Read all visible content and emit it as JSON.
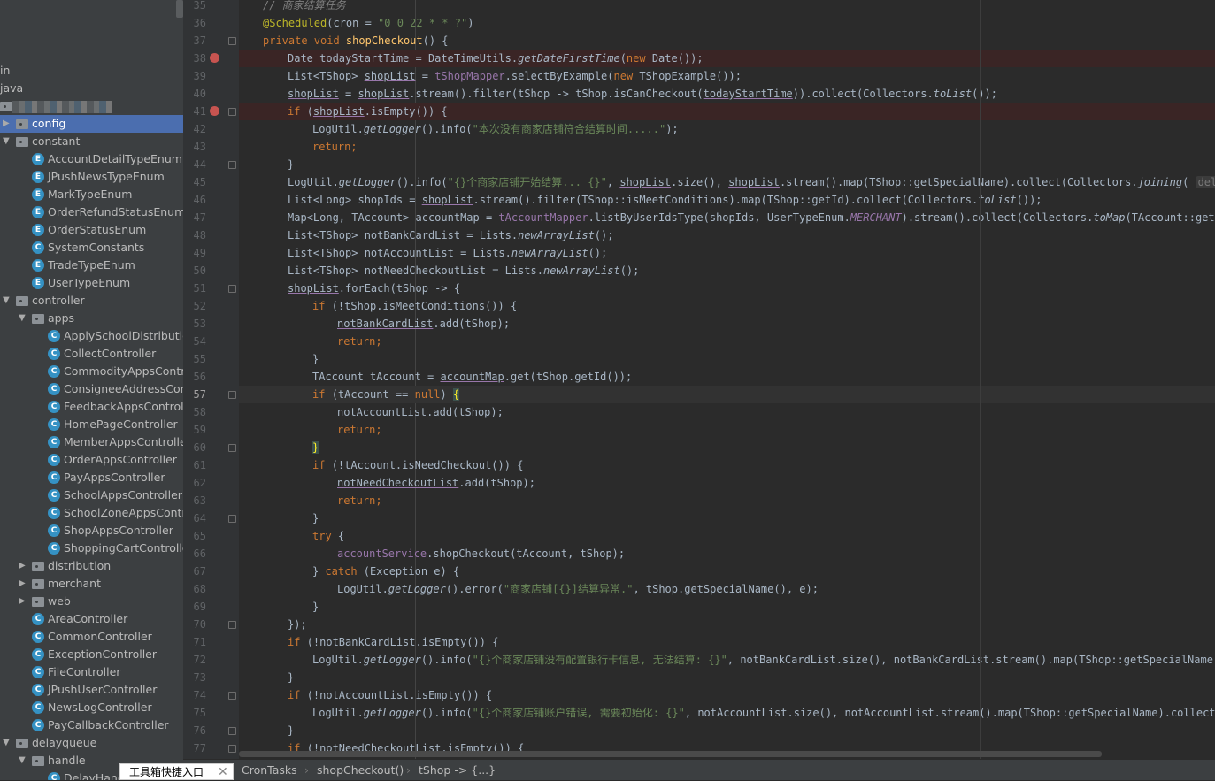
{
  "sidebar": {
    "rows": [
      {
        "label": "in",
        "level": -1,
        "kind": "none"
      },
      {
        "label": "java",
        "level": -1,
        "kind": "none"
      },
      {
        "label": "",
        "level": -1,
        "kind": "package-blurred"
      },
      {
        "label": "config",
        "level": 0,
        "kind": "folder",
        "arrow": "collapsed",
        "selected": true
      },
      {
        "label": "constant",
        "level": 0,
        "kind": "folder",
        "arrow": "expanded"
      },
      {
        "label": "AccountDetailTypeEnum",
        "level": 1,
        "kind": "enum"
      },
      {
        "label": "JPushNewsTypeEnum",
        "level": 1,
        "kind": "enum"
      },
      {
        "label": "MarkTypeEnum",
        "level": 1,
        "kind": "enum"
      },
      {
        "label": "OrderRefundStatusEnum",
        "level": 1,
        "kind": "enum"
      },
      {
        "label": "OrderStatusEnum",
        "level": 1,
        "kind": "enum"
      },
      {
        "label": "SystemConstants",
        "level": 1,
        "kind": "class"
      },
      {
        "label": "TradeTypeEnum",
        "level": 1,
        "kind": "enum"
      },
      {
        "label": "UserTypeEnum",
        "level": 1,
        "kind": "enum"
      },
      {
        "label": "controller",
        "level": 0,
        "kind": "folder",
        "arrow": "expanded"
      },
      {
        "label": "apps",
        "level": 1,
        "kind": "folder",
        "arrow": "expanded"
      },
      {
        "label": "ApplySchoolDistribution",
        "level": 2,
        "kind": "class"
      },
      {
        "label": "CollectController",
        "level": 2,
        "kind": "class"
      },
      {
        "label": "CommodityAppsContro",
        "level": 2,
        "kind": "class"
      },
      {
        "label": "ConsigneeAddressCont",
        "level": 2,
        "kind": "class"
      },
      {
        "label": "FeedbackAppsControlle",
        "level": 2,
        "kind": "class"
      },
      {
        "label": "HomePageController",
        "level": 2,
        "kind": "class"
      },
      {
        "label": "MemberAppsController",
        "level": 2,
        "kind": "class"
      },
      {
        "label": "OrderAppsController",
        "level": 2,
        "kind": "class"
      },
      {
        "label": "PayAppsController",
        "level": 2,
        "kind": "class"
      },
      {
        "label": "SchoolAppsController",
        "level": 2,
        "kind": "class"
      },
      {
        "label": "SchoolZoneAppsContro",
        "level": 2,
        "kind": "class"
      },
      {
        "label": "ShopAppsController",
        "level": 2,
        "kind": "class"
      },
      {
        "label": "ShoppingCartController",
        "level": 2,
        "kind": "class"
      },
      {
        "label": "distribution",
        "level": 1,
        "kind": "folder",
        "arrow": "collapsed"
      },
      {
        "label": "merchant",
        "level": 1,
        "kind": "folder",
        "arrow": "collapsed"
      },
      {
        "label": "web",
        "level": 1,
        "kind": "folder",
        "arrow": "collapsed"
      },
      {
        "label": "AreaController",
        "level": 1,
        "kind": "class"
      },
      {
        "label": "CommonController",
        "level": 1,
        "kind": "class"
      },
      {
        "label": "ExceptionController",
        "level": 1,
        "kind": "class"
      },
      {
        "label": "FileController",
        "level": 1,
        "kind": "class"
      },
      {
        "label": "JPushUserController",
        "level": 1,
        "kind": "class"
      },
      {
        "label": "NewsLogController",
        "level": 1,
        "kind": "class"
      },
      {
        "label": "PayCallbackController",
        "level": 1,
        "kind": "class"
      },
      {
        "label": "delayqueue",
        "level": 0,
        "kind": "folder",
        "arrow": "expanded"
      },
      {
        "label": "handle",
        "level": 1,
        "kind": "folder",
        "arrow": "expanded"
      },
      {
        "label": "DelayHand",
        "level": 2,
        "kind": "class"
      }
    ]
  },
  "editor": {
    "first_line": 35,
    "breakpoints": [
      38,
      41
    ],
    "current_line": 57,
    "folds": [
      37,
      41,
      44,
      51,
      57,
      60,
      64,
      70,
      74,
      76,
      77
    ],
    "lines": [
      {
        "indent": 0,
        "t": [
          [
            "c",
            "// 商家结算任务"
          ]
        ]
      },
      {
        "indent": 0,
        "t": [
          [
            "a",
            "@Scheduled"
          ],
          [
            "",
            "(cron = "
          ],
          [
            "s",
            "\"0 0 22 * * ?\""
          ],
          [
            "",
            ")"
          ]
        ]
      },
      {
        "indent": 0,
        "t": [
          [
            "k",
            "private void "
          ],
          [
            "m",
            "shopCheckout"
          ],
          [
            "",
            "() {"
          ]
        ]
      },
      {
        "indent": 1,
        "t": [
          [
            "",
            "Date todayStartTime = DateTimeUtils."
          ],
          [
            "i",
            "getDateFirstTime"
          ],
          [
            "",
            "("
          ],
          [
            "k",
            "new "
          ],
          [
            "",
            "Date());"
          ]
        ]
      },
      {
        "indent": 1,
        "t": [
          [
            "",
            "List<TShop> "
          ],
          [
            "u",
            "shopList"
          ],
          [
            "",
            " = "
          ],
          [
            "f",
            "tShopMapper"
          ],
          [
            "",
            ".selectByExample("
          ],
          [
            "k",
            "new "
          ],
          [
            "",
            "TShopExample());"
          ]
        ]
      },
      {
        "indent": 1,
        "t": [
          [
            "u",
            "shopList"
          ],
          [
            "",
            " = "
          ],
          [
            "u",
            "shopList"
          ],
          [
            "",
            ".stream().filter(tShop -> tShop.isCanCheckout("
          ],
          [
            "u",
            "todayStartTime"
          ],
          [
            "",
            ")).collect(Collectors."
          ],
          [
            "i",
            "toList"
          ],
          [
            "",
            "());"
          ]
        ]
      },
      {
        "indent": 1,
        "t": [
          [
            "k",
            "if "
          ],
          [
            "",
            "("
          ],
          [
            "u",
            "shopList"
          ],
          [
            "",
            ".isEmpty()) {"
          ]
        ]
      },
      {
        "indent": 2,
        "t": [
          [
            "",
            "LogUtil."
          ],
          [
            "i",
            "getLogger"
          ],
          [
            "",
            "().info("
          ],
          [
            "s",
            "\"本次没有商家店铺符合结算时间.....\""
          ],
          [
            "",
            ");"
          ]
        ]
      },
      {
        "indent": 2,
        "t": [
          [
            "k",
            "return;"
          ]
        ]
      },
      {
        "indent": 1,
        "t": [
          [
            "",
            "}"
          ]
        ]
      },
      {
        "indent": 1,
        "t": [
          [
            "",
            "LogUtil."
          ],
          [
            "i",
            "getLogger"
          ],
          [
            "",
            "().info("
          ],
          [
            "s",
            "\"{}个商家店铺开始结算... {}\""
          ],
          [
            "",
            ", "
          ],
          [
            "u",
            "shopList"
          ],
          [
            "",
            ".size(), "
          ],
          [
            "u",
            "shopList"
          ],
          [
            "",
            ".stream().map(TShop::getSpecialName).collect(Collectors."
          ],
          [
            "i",
            "joining"
          ],
          [
            "",
            "( "
          ],
          [
            "h",
            "delimiter"
          ]
        ]
      },
      {
        "indent": 1,
        "t": [
          [
            "",
            "List<Long> shopIds = "
          ],
          [
            "u",
            "shopList"
          ],
          [
            "",
            ".stream().filter(TShop::isMeetConditions).map(TShop::getId).collect(Collectors."
          ],
          [
            "i",
            "toList"
          ],
          [
            "",
            "());"
          ]
        ]
      },
      {
        "indent": 1,
        "t": [
          [
            "",
            "Map<Long, TAccount> accountMap = "
          ],
          [
            "f",
            "tAccountMapper"
          ],
          [
            "",
            ".listByUserIdsType(shopIds, UserTypeEnum."
          ],
          [
            "fi",
            "MERCHANT"
          ],
          [
            "",
            ").stream().collect(Collectors."
          ],
          [
            "i",
            "toMap"
          ],
          [
            "",
            "(TAccount::getUserId"
          ]
        ]
      },
      {
        "indent": 1,
        "t": [
          [
            "",
            "List<TShop> notBankCardList = Lists."
          ],
          [
            "i",
            "newArrayList"
          ],
          [
            "",
            "();"
          ]
        ]
      },
      {
        "indent": 1,
        "t": [
          [
            "",
            "List<TShop> notAccountList = Lists."
          ],
          [
            "i",
            "newArrayList"
          ],
          [
            "",
            "();"
          ]
        ]
      },
      {
        "indent": 1,
        "t": [
          [
            "",
            "List<TShop> notNeedCheckoutList = Lists."
          ],
          [
            "i",
            "newArrayList"
          ],
          [
            "",
            "();"
          ]
        ]
      },
      {
        "indent": 1,
        "t": [
          [
            "u",
            "shopList"
          ],
          [
            "",
            ".forEach(tShop -> {"
          ]
        ]
      },
      {
        "indent": 2,
        "t": [
          [
            "k",
            "if "
          ],
          [
            "",
            "(!tShop.isMeetConditions()) {"
          ]
        ]
      },
      {
        "indent": 3,
        "t": [
          [
            "u",
            "notBankCardList"
          ],
          [
            "",
            ".add(tShop);"
          ]
        ]
      },
      {
        "indent": 3,
        "t": [
          [
            "k",
            "return;"
          ]
        ]
      },
      {
        "indent": 2,
        "t": [
          [
            "",
            "}"
          ]
        ]
      },
      {
        "indent": 2,
        "t": [
          [
            "",
            "TAccount tAccount = "
          ],
          [
            "u",
            "accountMap"
          ],
          [
            "",
            ".get(tShop.getId());"
          ]
        ]
      },
      {
        "indent": 2,
        "t": [
          [
            "k",
            "if "
          ],
          [
            "",
            "(tAccount == "
          ],
          [
            "k",
            "null"
          ],
          [
            "",
            ") "
          ],
          [
            "b",
            "{"
          ]
        ]
      },
      {
        "indent": 3,
        "t": [
          [
            "u",
            "notAccountList"
          ],
          [
            "",
            ".add(tShop);"
          ]
        ]
      },
      {
        "indent": 3,
        "t": [
          [
            "k",
            "return;"
          ]
        ]
      },
      {
        "indent": 2,
        "t": [
          [
            "b",
            "}"
          ]
        ]
      },
      {
        "indent": 2,
        "t": [
          [
            "k",
            "if "
          ],
          [
            "",
            "(!tAccount.isNeedCheckout()) {"
          ]
        ]
      },
      {
        "indent": 3,
        "t": [
          [
            "u",
            "notNeedCheckoutList"
          ],
          [
            "",
            ".add(tShop);"
          ]
        ]
      },
      {
        "indent": 3,
        "t": [
          [
            "k",
            "return;"
          ]
        ]
      },
      {
        "indent": 2,
        "t": [
          [
            "",
            "}"
          ]
        ]
      },
      {
        "indent": 2,
        "t": [
          [
            "k",
            "try"
          ],
          [
            "",
            " {"
          ]
        ]
      },
      {
        "indent": 3,
        "t": [
          [
            "f",
            "accountService"
          ],
          [
            "",
            ".shopCheckout(tAccount, tShop);"
          ]
        ]
      },
      {
        "indent": 2,
        "t": [
          [
            "",
            "} "
          ],
          [
            "k",
            "catch"
          ],
          [
            "",
            " (Exception e) {"
          ]
        ]
      },
      {
        "indent": 3,
        "t": [
          [
            "",
            "LogUtil."
          ],
          [
            "i",
            "getLogger"
          ],
          [
            "",
            "().error("
          ],
          [
            "s",
            "\"商家店铺[{}]结算异常.\""
          ],
          [
            "",
            ", tShop.getSpecialName(), e);"
          ]
        ]
      },
      {
        "indent": 2,
        "t": [
          [
            "",
            "}"
          ]
        ]
      },
      {
        "indent": 1,
        "t": [
          [
            "",
            "});"
          ]
        ]
      },
      {
        "indent": 1,
        "t": [
          [
            "k",
            "if "
          ],
          [
            "",
            "(!notBankCardList.isEmpty()) {"
          ]
        ]
      },
      {
        "indent": 2,
        "t": [
          [
            "",
            "LogUtil."
          ],
          [
            "i",
            "getLogger"
          ],
          [
            "",
            "().info("
          ],
          [
            "s",
            "\"{}个商家店铺没有配置银行卡信息, 无法结算: {}\""
          ],
          [
            "",
            ", notBankCardList.size(), notBankCardList.stream().map(TShop::getSpecialName)"
          ]
        ]
      },
      {
        "indent": 1,
        "t": [
          [
            "",
            "}"
          ]
        ]
      },
      {
        "indent": 1,
        "t": [
          [
            "k",
            "if "
          ],
          [
            "",
            "(!notAccountList.isEmpty()) {"
          ]
        ]
      },
      {
        "indent": 2,
        "t": [
          [
            "",
            "LogUtil."
          ],
          [
            "i",
            "getLogger"
          ],
          [
            "",
            "().info("
          ],
          [
            "s",
            "\"{}个商家店铺账户错误, 需要初始化: {}\""
          ],
          [
            "",
            ", notAccountList.size(), notAccountList.stream().map(TShop::getSpecialName).collect(C"
          ]
        ]
      },
      {
        "indent": 1,
        "t": [
          [
            "",
            "}"
          ]
        ]
      },
      {
        "indent": 1,
        "t": [
          [
            "k",
            "if "
          ],
          [
            "",
            "(!notNeedCheckoutList.isEmpty()) {"
          ]
        ]
      }
    ]
  },
  "breadcrumb": [
    "CronTasks",
    "shopCheckout()",
    "tShop -> {...}"
  ],
  "popup": {
    "label": "工具箱快捷入口",
    "close_icon": "close-icon"
  },
  "colors": {
    "selection": "#4b6eaf",
    "keyword": "#cc7832",
    "string": "#6a8759",
    "field": "#9876aa",
    "breakpoint": "#c75450"
  }
}
